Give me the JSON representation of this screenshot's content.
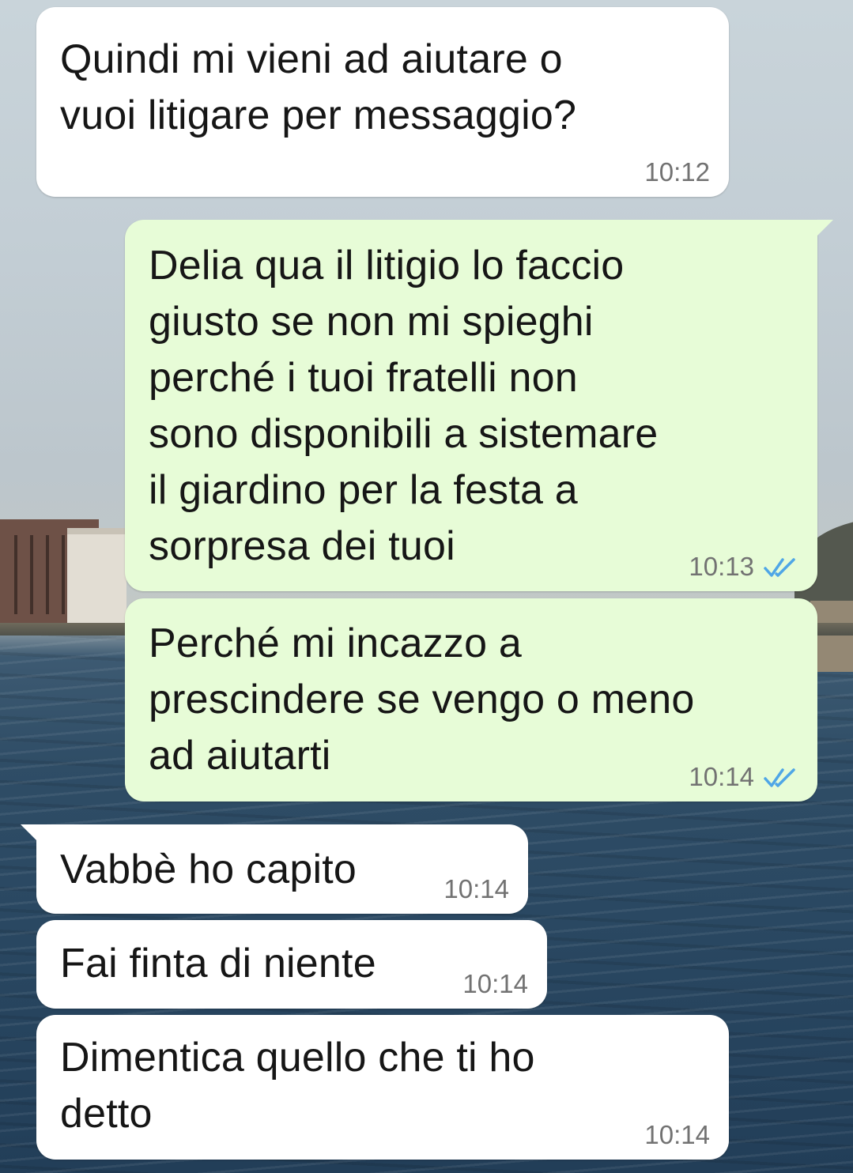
{
  "theme": {
    "incoming_bubble": "#ffffff",
    "outgoing_bubble": "#e7fcd7",
    "read_tick_color": "#4fa6e6",
    "timestamp_color": "#727272"
  },
  "messages": [
    {
      "direction": "incoming",
      "text": "Quindi mi vieni ad aiutare o\nvuoi litigare per messaggio?",
      "time": "10:12"
    },
    {
      "direction": "outgoing",
      "text": "Delia qua il litigio lo faccio\ngiusto se non mi spieghi\nperché i tuoi fratelli non\nsono disponibili a sistemare\nil giardino per la festa a\nsorpresa dei tuoi",
      "time": "10:13",
      "status": "read-double-tick-icon"
    },
    {
      "direction": "outgoing",
      "text": "Perché mi incazzo a\nprescindere se vengo o meno\nad aiutarti",
      "time": "10:14",
      "status": "read-double-tick-icon"
    },
    {
      "direction": "incoming",
      "text": "Vabbè ho capito",
      "time": "10:14"
    },
    {
      "direction": "incoming",
      "text": "Fai finta di niente",
      "time": "10:14"
    },
    {
      "direction": "incoming",
      "text": "Dimentica quello che ti ho\ndetto",
      "time": "10:14"
    }
  ]
}
